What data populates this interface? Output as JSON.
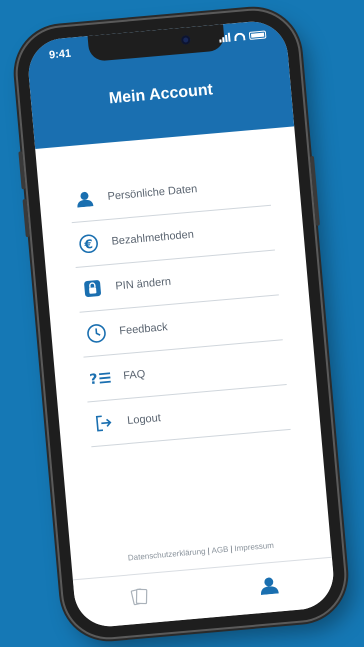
{
  "status": {
    "time": "9:41"
  },
  "header": {
    "title": "Mein Account"
  },
  "menu": [
    {
      "label": "Persönliche Daten",
      "icon": "person-icon"
    },
    {
      "label": "Bezahlmethoden",
      "icon": "euro-icon"
    },
    {
      "label": "PIN ändern",
      "icon": "lock-icon"
    },
    {
      "label": "Feedback",
      "icon": "clock-icon"
    },
    {
      "label": "FAQ",
      "icon": "question-list-icon"
    },
    {
      "label": "Logout",
      "icon": "logout-icon"
    }
  ],
  "footer": {
    "privacy": "Datenschutzerklärung",
    "terms": "AGB",
    "imprint": "Impressum",
    "separator": "|"
  },
  "tabbar": {
    "tabs": [
      {
        "icon": "tickets-icon",
        "active": false
      },
      {
        "icon": "person-icon",
        "active": true
      }
    ]
  },
  "colors": {
    "background": "#1578b5",
    "primary": "#1a6fb0",
    "text": "#5a6470"
  }
}
